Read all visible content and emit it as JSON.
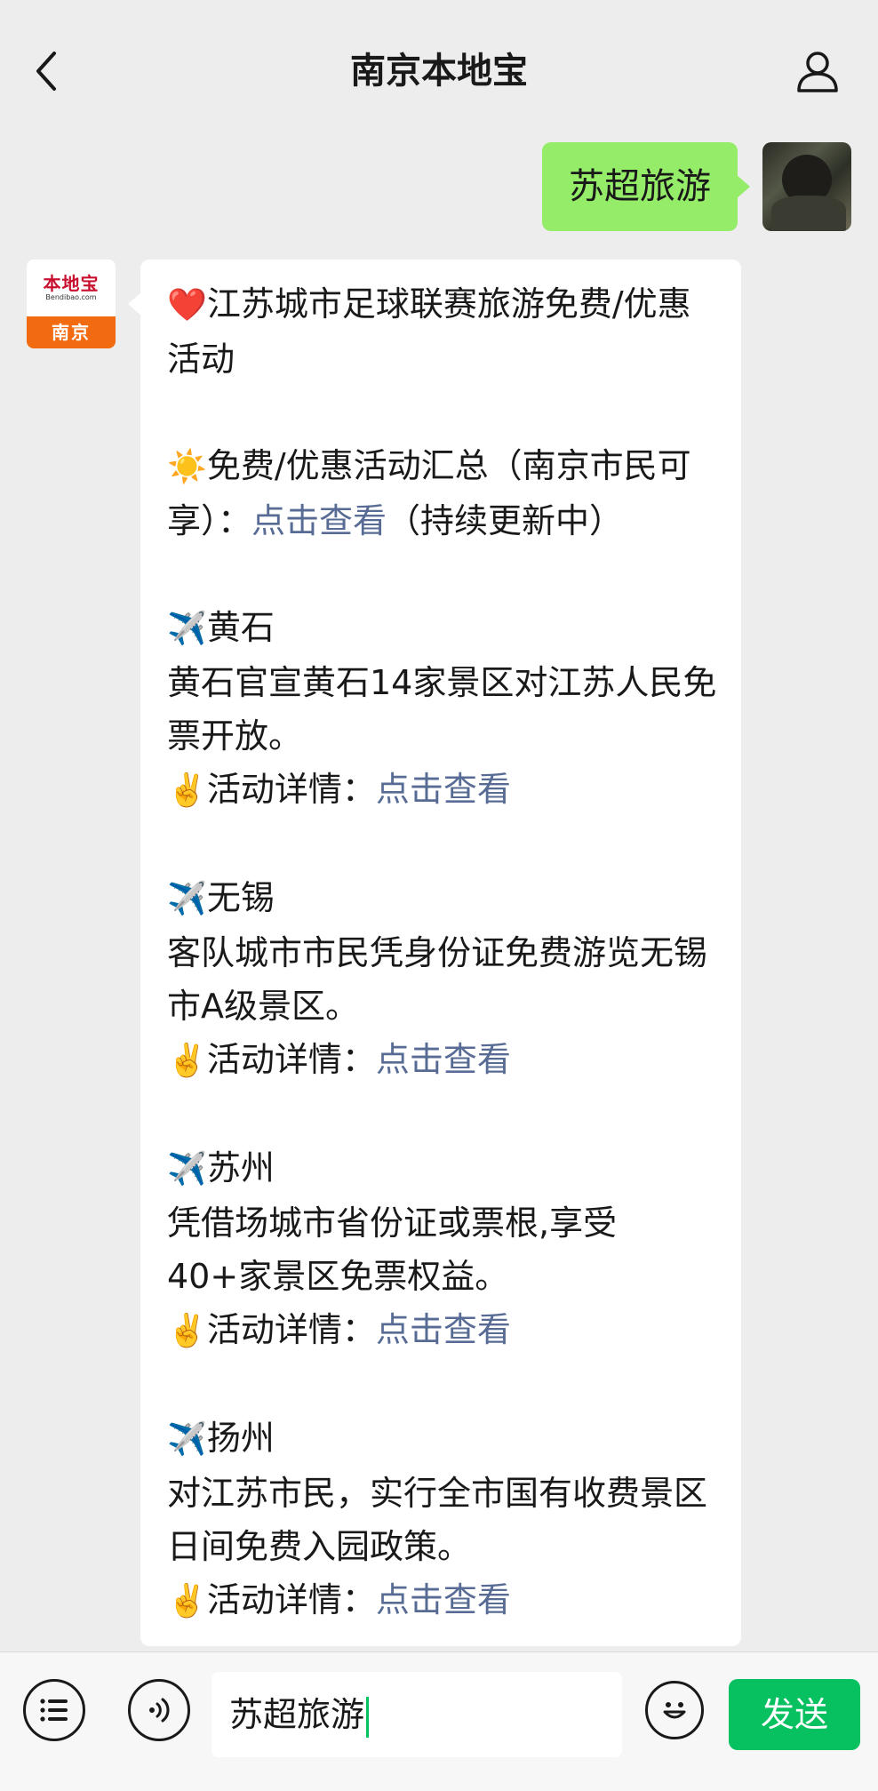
{
  "header": {
    "title": "南京本地宝"
  },
  "outgoing": {
    "text": "苏超旅游"
  },
  "bot": {
    "brand": "本地宝",
    "brand_url": "Bendibao.com",
    "city": "南京"
  },
  "message": {
    "heading": "江苏城市足球联赛旅游免费/优惠活动",
    "summary_text": "免费/优惠活动汇总（南京市民可享）：",
    "summary_link": "点击查看",
    "summary_tail": "（持续更新中）",
    "sections": [
      {
        "city": "黄石",
        "desc": "黄石官宣黄石14家景区对江苏人民免票开放。",
        "detail_label": "活动详情：",
        "detail_link": "点击查看"
      },
      {
        "city": "无锡",
        "desc": "客队城市市民凭身份证免费游览无锡市A级景区。",
        "detail_label": "活动详情：",
        "detail_link": "点击查看"
      },
      {
        "city": "苏州",
        "desc": "凭借场城市省份证或票根,享受40+家景区免票权益。",
        "detail_label": "活动详情：",
        "detail_link": "点击查看"
      },
      {
        "city": "扬州",
        "desc": "对江苏市民，实行全市国有收费景区日间免费入园政策。",
        "detail_label": "活动详情：",
        "detail_link": "点击查看"
      }
    ]
  },
  "input": {
    "value": "苏超旅游"
  },
  "send_label": "发送",
  "icons": {
    "heart": "❤️",
    "sun": "☀️",
    "plane": "✈️",
    "victory": "✌️"
  },
  "colors": {
    "outgoing_bubble": "#95ec69",
    "link": "#576b95",
    "send": "#07c160",
    "brand_orange": "#f26b11"
  }
}
